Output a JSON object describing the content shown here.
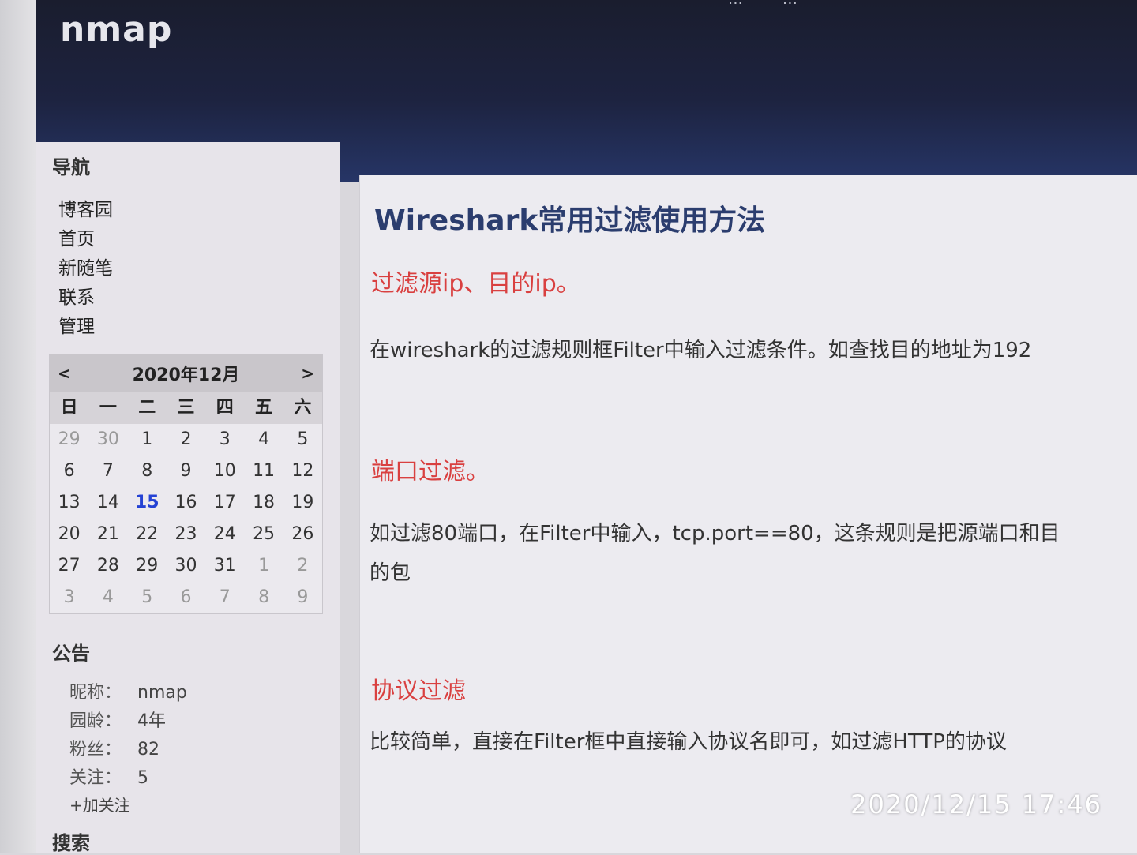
{
  "header": {
    "blog_title": "nmap",
    "top_nav": [
      "...",
      "..."
    ]
  },
  "sidebar": {
    "nav_heading": "导航",
    "nav_items": [
      "博客园",
      "首页",
      "新随笔",
      "联系",
      "管理"
    ],
    "calendar": {
      "prev": "<",
      "next": ">",
      "month_label": "2020年12月",
      "weekdays": [
        "日",
        "一",
        "二",
        "三",
        "四",
        "五",
        "六"
      ],
      "weeks": [
        [
          "29",
          "30",
          "1",
          "2",
          "3",
          "4",
          "5"
        ],
        [
          "6",
          "7",
          "8",
          "9",
          "10",
          "11",
          "12"
        ],
        [
          "13",
          "14",
          "15",
          "16",
          "17",
          "18",
          "19"
        ],
        [
          "20",
          "21",
          "22",
          "23",
          "24",
          "25",
          "26"
        ],
        [
          "27",
          "28",
          "29",
          "30",
          "31",
          "1",
          "2"
        ],
        [
          "3",
          "4",
          "5",
          "6",
          "7",
          "8",
          "9"
        ]
      ],
      "today": "15"
    },
    "notice_heading": "公告",
    "profile": [
      {
        "label": "昵称：",
        "value": "nmap"
      },
      {
        "label": "园龄：",
        "value": "4年"
      },
      {
        "label": "粉丝：",
        "value": "82"
      },
      {
        "label": "关注：",
        "value": "5"
      }
    ],
    "follow_link": "+加关注",
    "search_heading": "搜索"
  },
  "post": {
    "title": "Wireshark常用过滤使用方法",
    "sections": [
      {
        "heading": "过滤源ip、目的ip。",
        "lines": [
          "在wireshark的过滤规则框Filter中输入过滤条件。如查找目的地址为192"
        ]
      },
      {
        "heading": "端口过滤。",
        "lines": [
          "如过滤80端口，在Filter中输入，tcp.port==80，这条规则是把源端口和目",
          "的包"
        ]
      },
      {
        "heading": "协议过滤",
        "lines": [
          "比较简单，直接在Filter框中直接输入协议名即可，如过滤HTTP的协议"
        ]
      }
    ]
  },
  "photo_timestamp": "2020/12/15  17:46",
  "colors": {
    "header_bg": "#1d2340",
    "title": "#2b3d6e",
    "subheading": "#d94040",
    "today": "#2442d4"
  }
}
